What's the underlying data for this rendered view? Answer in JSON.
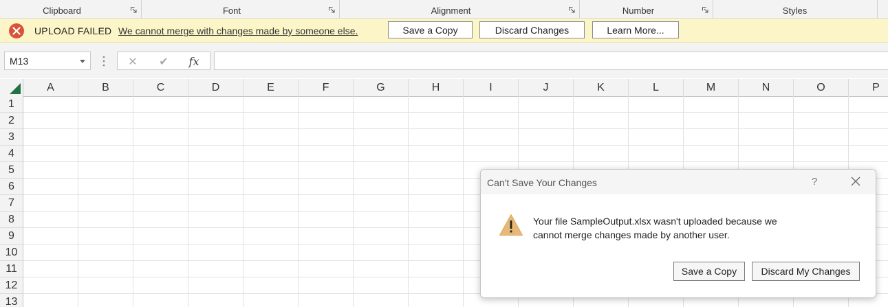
{
  "ribbon": {
    "groups": [
      {
        "label": "Clipboard"
      },
      {
        "label": "Font"
      },
      {
        "label": "Alignment"
      },
      {
        "label": "Number"
      },
      {
        "label": "Styles"
      }
    ]
  },
  "message_bar": {
    "title": "UPLOAD FAILED",
    "message": "We cannot merge with changes made by someone else.",
    "buttons": {
      "save_copy": "Save a Copy",
      "discard": "Discard Changes",
      "learn_more": "Learn More..."
    },
    "background_color": "#fcf5c7",
    "error_icon": "error-x-icon",
    "error_color": "#d9533a"
  },
  "formula_bar": {
    "name_box": "M13",
    "cancel_icon": "✕",
    "enter_icon": "✔",
    "function_icon": "fx",
    "formula": ""
  },
  "grid": {
    "columns": [
      "A",
      "B",
      "C",
      "D",
      "E",
      "F",
      "G",
      "H",
      "I",
      "J",
      "K",
      "L",
      "M",
      "N",
      "O",
      "P"
    ],
    "rows": [
      "1",
      "2",
      "3",
      "4",
      "5",
      "6",
      "7",
      "8",
      "9",
      "10",
      "11",
      "12",
      "13"
    ]
  },
  "dialog": {
    "title": "Can't Save Your Changes",
    "help": "?",
    "message": "Your file SampleOutput.xlsx wasn't uploaded because we cannot merge changes made by another user.",
    "buttons": {
      "save_copy": "Save a Copy",
      "discard": "Discard My Changes"
    },
    "warning_icon": "warning-icon",
    "warning_color": "#e8b877"
  }
}
